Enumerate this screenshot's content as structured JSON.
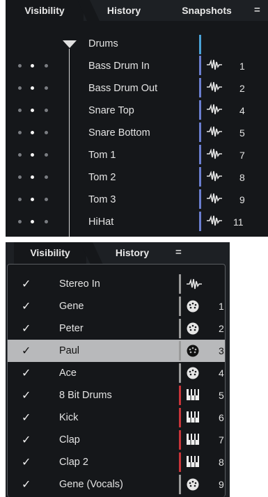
{
  "panel1": {
    "tabs": [
      "Visibility",
      "History",
      "Snapshots"
    ],
    "menu_glyph": "=",
    "folder": {
      "name": "Drums",
      "bar_color": "#4aa3d8"
    },
    "rows": [
      {
        "name": "Bass Drum In",
        "num": "1",
        "bar_color": "#6b7fd0"
      },
      {
        "name": "Bass Drum Out",
        "num": "2",
        "bar_color": "#6b7fd0"
      },
      {
        "name": "Snare Top",
        "num": "4",
        "bar_color": "#6b7fd0"
      },
      {
        "name": "Snare Bottom",
        "num": "5",
        "bar_color": "#6b7fd0"
      },
      {
        "name": "Tom 1",
        "num": "7",
        "bar_color": "#6b7fd0"
      },
      {
        "name": "Tom 2",
        "num": "8",
        "bar_color": "#6b7fd0"
      },
      {
        "name": "Tom 3",
        "num": "9",
        "bar_color": "#6b7fd0"
      },
      {
        "name": "HiHat",
        "num": "11",
        "bar_color": "#6b7fd0"
      }
    ]
  },
  "panel2": {
    "tabs": [
      "Visibility",
      "History"
    ],
    "menu_glyph": "=",
    "check_glyph": "✓",
    "rows": [
      {
        "name": "Stereo In",
        "num": "",
        "icon": "waveform-icon",
        "bar_color": "#9a9a9a",
        "selected": false
      },
      {
        "name": "Gene",
        "num": "1",
        "icon": "midi-plug-icon",
        "bar_color": "#9a9a9a",
        "selected": false
      },
      {
        "name": "Peter",
        "num": "2",
        "icon": "midi-plug-icon",
        "bar_color": "#9a9a9a",
        "selected": false
      },
      {
        "name": "Paul",
        "num": "3",
        "icon": "midi-plug-icon",
        "bar_color": "#9a9a9a",
        "selected": true
      },
      {
        "name": "Ace",
        "num": "4",
        "icon": "midi-plug-icon",
        "bar_color": "#9a9a9a",
        "selected": false
      },
      {
        "name": "8 Bit Drums",
        "num": "5",
        "icon": "instrument-keys-icon",
        "bar_color": "#c8353a",
        "selected": false
      },
      {
        "name": "Kick",
        "num": "6",
        "icon": "instrument-keys-icon",
        "bar_color": "#c8353a",
        "selected": false
      },
      {
        "name": "Clap",
        "num": "7",
        "icon": "instrument-keys-icon",
        "bar_color": "#c8353a",
        "selected": false
      },
      {
        "name": "Clap 2",
        "num": "8",
        "icon": "instrument-keys-icon",
        "bar_color": "#c8353a",
        "selected": false
      },
      {
        "name": "Gene (Vocals)",
        "num": "9",
        "icon": "midi-plug-icon",
        "bar_color": "#9a9a9a",
        "selected": false
      }
    ]
  }
}
